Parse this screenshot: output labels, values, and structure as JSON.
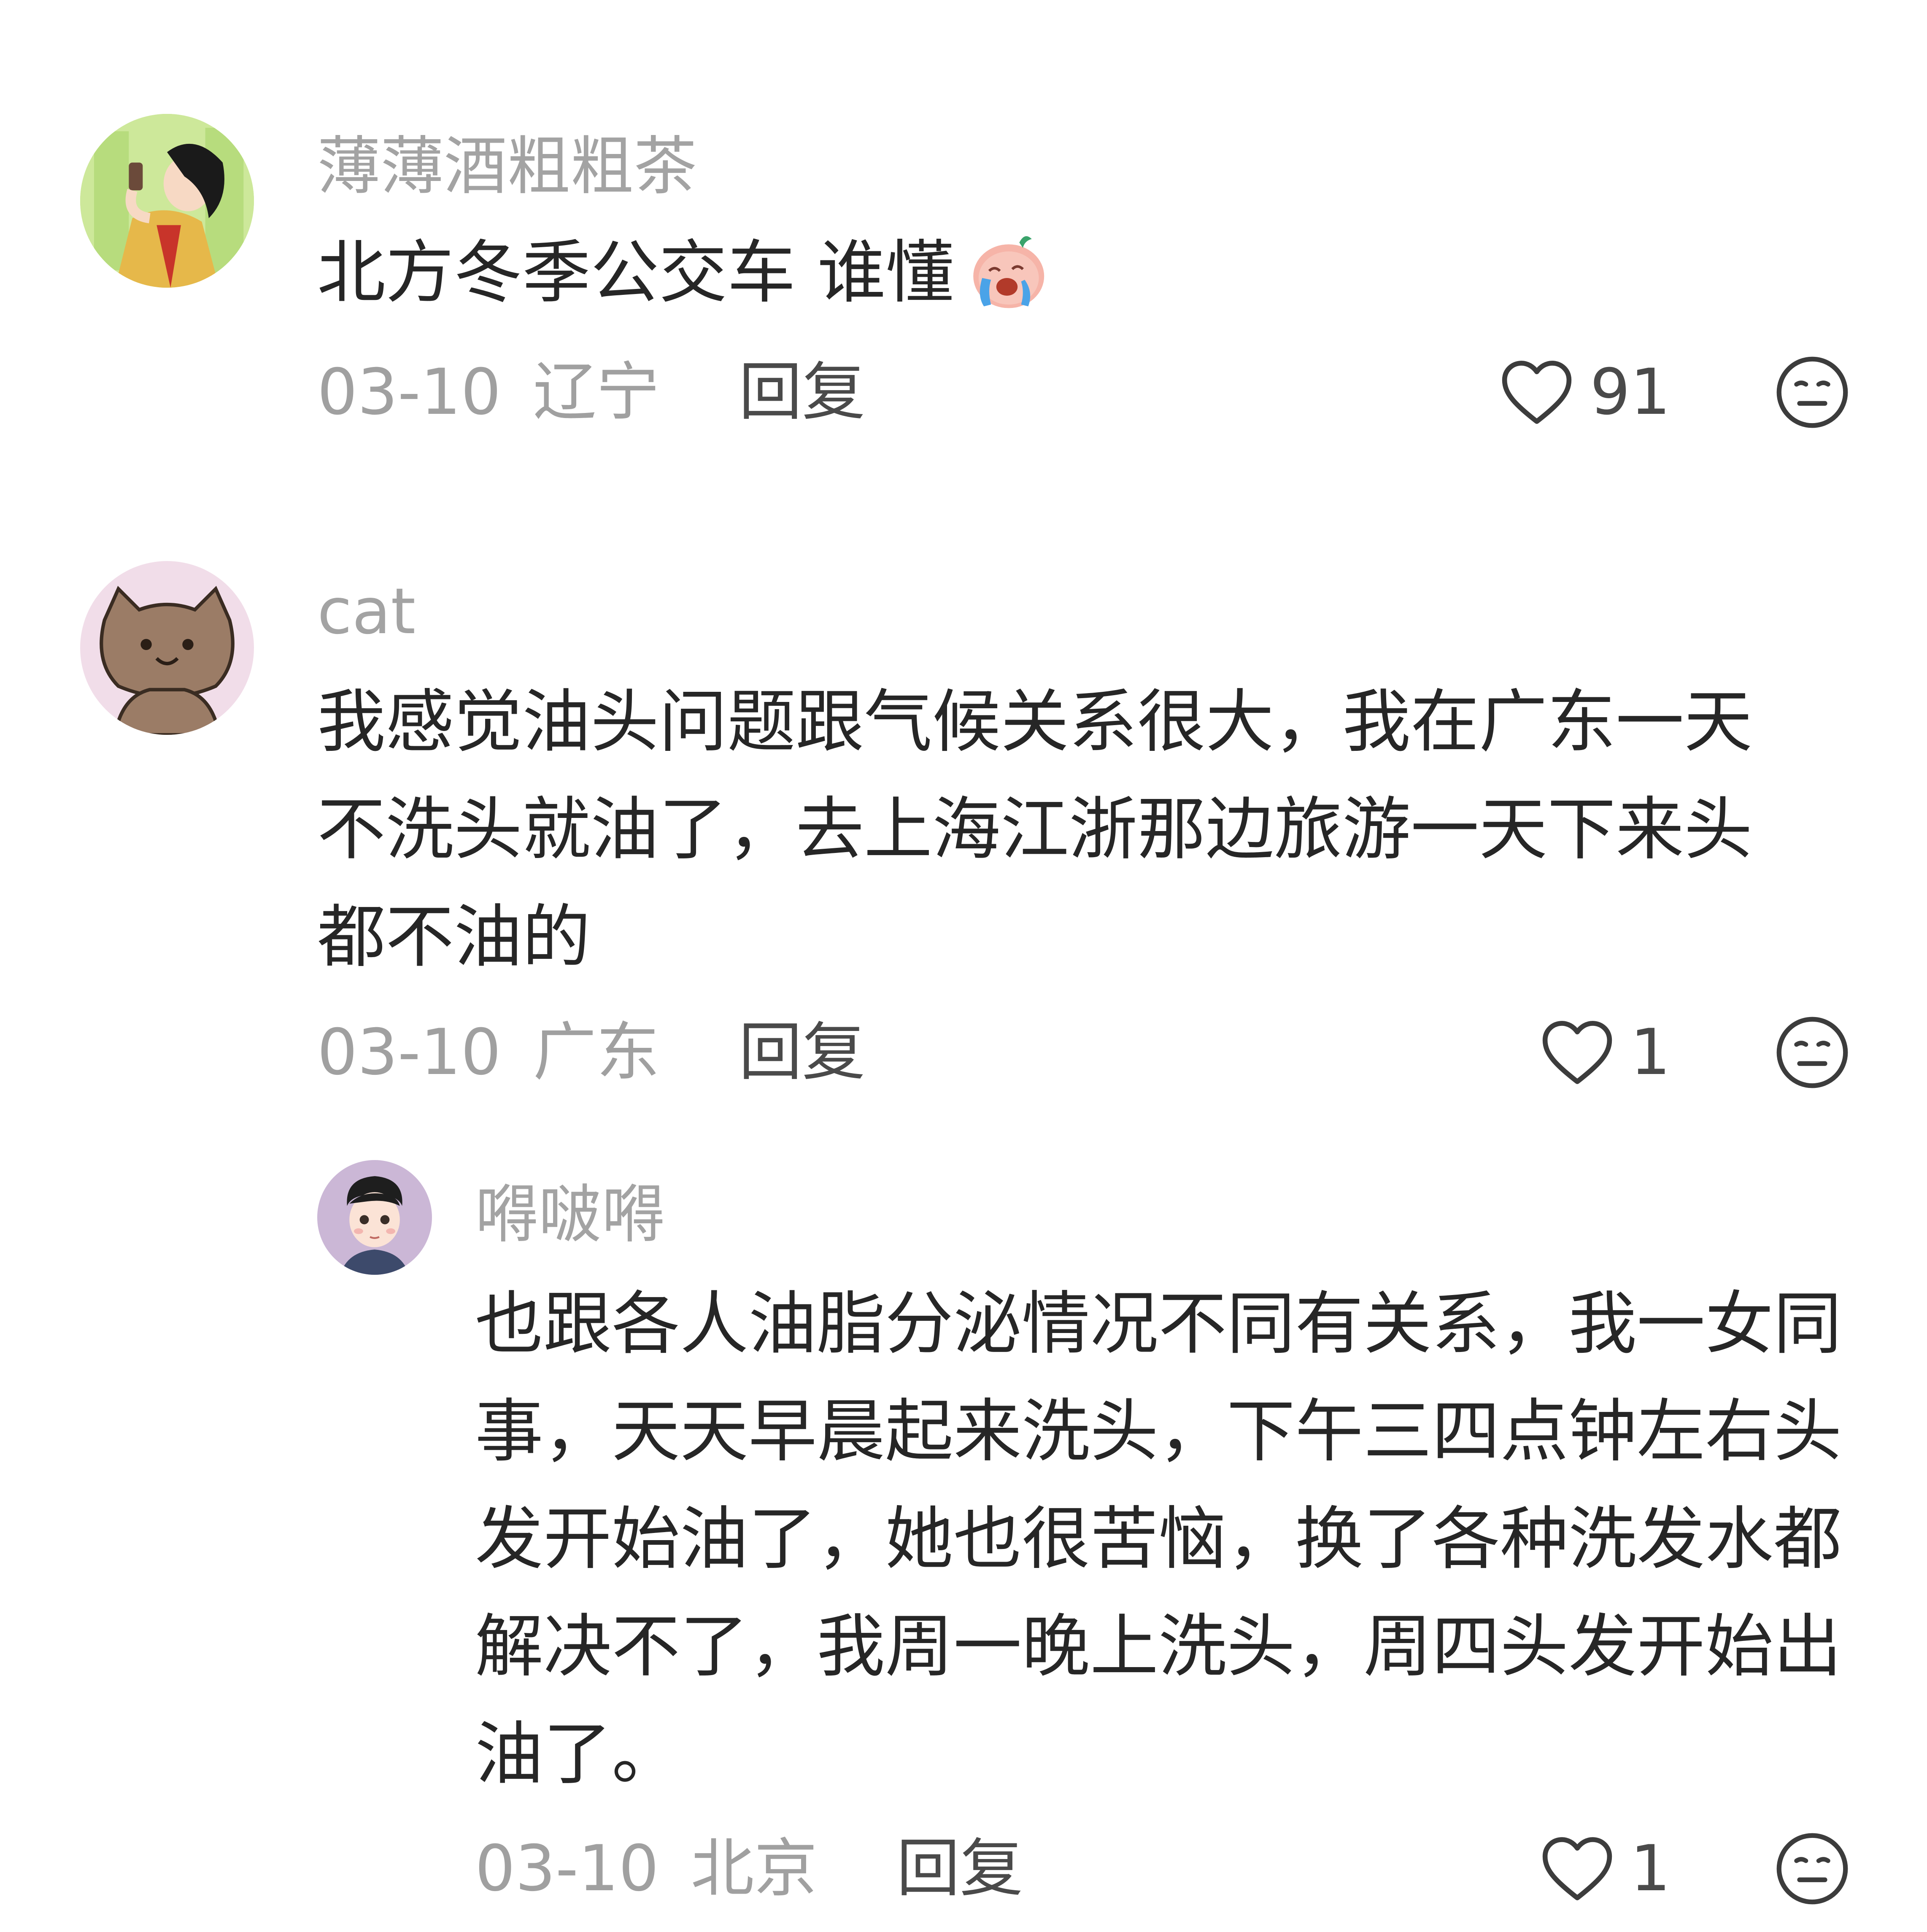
{
  "comments": [
    {
      "username": "薄薄酒粗粗茶",
      "content": "北方冬季公交车 谁懂",
      "emoji": "crying-face-emoji",
      "date": "03-10",
      "location": "辽宁",
      "reply_label": "回复",
      "likes": "91"
    },
    {
      "username": "cat",
      "content": "我感觉油头问题跟气候关系很大，我在广东一天不洗头就油了，去上海江浙那边旅游一天下来头都不油的",
      "date": "03-10",
      "location": "广东",
      "reply_label": "回复",
      "likes": "1",
      "replies": [
        {
          "username": "嘚啵嘚",
          "content": "也跟各人油脂分泌情况不同有关系，我一女同事，天天早晨起来洗头，下午三四点钟左右头发开始油了，她也很苦恼，换了各种洗发水都解决不了，我周一晚上洗头，周四头发开始出油了。",
          "date": "03-10",
          "location": "北京",
          "reply_label": "回复",
          "likes": "1"
        }
      ]
    }
  ],
  "icons": {
    "like": "heart-outline-icon",
    "dislike": "neutral-face-icon"
  },
  "colors": {
    "username": "#a3a3a3",
    "content": "#262626",
    "meta": "#a0a0a0",
    "icon": "#3c3c3c"
  }
}
